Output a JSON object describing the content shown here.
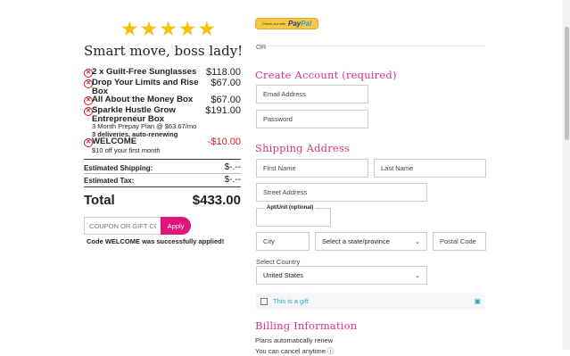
{
  "summary": {
    "stars": "★★★★★",
    "headline": "Smart move, boss lady!",
    "items": [
      {
        "name": "2 x Guilt-Free Sunglasses",
        "price": "$118.00"
      },
      {
        "name": "Drop Your Limits and Rise Box",
        "price": "$67.00"
      },
      {
        "name": "All About the Money Box",
        "price": "$67.00"
      },
      {
        "name": "Sparkle Hustle Grow Entrepreneur Box",
        "price": "$191.00",
        "sub1": "3 Month Prepay Plan @ $63.67/mo",
        "sub2": "3 deliveries, auto-renewing"
      },
      {
        "name": "WELCOME",
        "price": "-$10.00",
        "sub1": "$10 off your first month",
        "price_color": "#d11a2a"
      }
    ],
    "shipping_label": "Estimated Shipping:",
    "shipping_value": "$-.--",
    "tax_label": "Estimated Tax:",
    "tax_value": "$-.--",
    "total_label": "Total",
    "total_value": "$433.00",
    "coupon_placeholder": "COUPON OR GIFT CODE",
    "apply_label": "Apply",
    "applied_message": "Code WELCOME was successfully applied!"
  },
  "paypal": {
    "small": "Check out with",
    "pay": "Pay",
    "pal": "Pal"
  },
  "or_label": "OR",
  "account": {
    "title": "Create Account (required)",
    "email_placeholder": "Email Address",
    "password_placeholder": "Password"
  },
  "shipping": {
    "title": "Shipping Address",
    "first_name": "First Name",
    "last_name": "Last Name",
    "street": "Street Address",
    "apt_label": "Apt/Unit (optional)",
    "city": "City",
    "state_value": "Select a state/province",
    "postal": "Postal Code",
    "country_label": "Select Country",
    "country_value": "United States",
    "gift_label": "This is a gift"
  },
  "billing": {
    "title": "Billing Information",
    "plans_text": "Plans automatically renew",
    "cancel_text": "You can cancel anytime"
  },
  "colors": {
    "accent": "#e0157b",
    "heading": "#d6347b",
    "remove": "#d11a2a",
    "gift_text": "#2aa9b8",
    "paypal_yellow": "#f7c843"
  }
}
